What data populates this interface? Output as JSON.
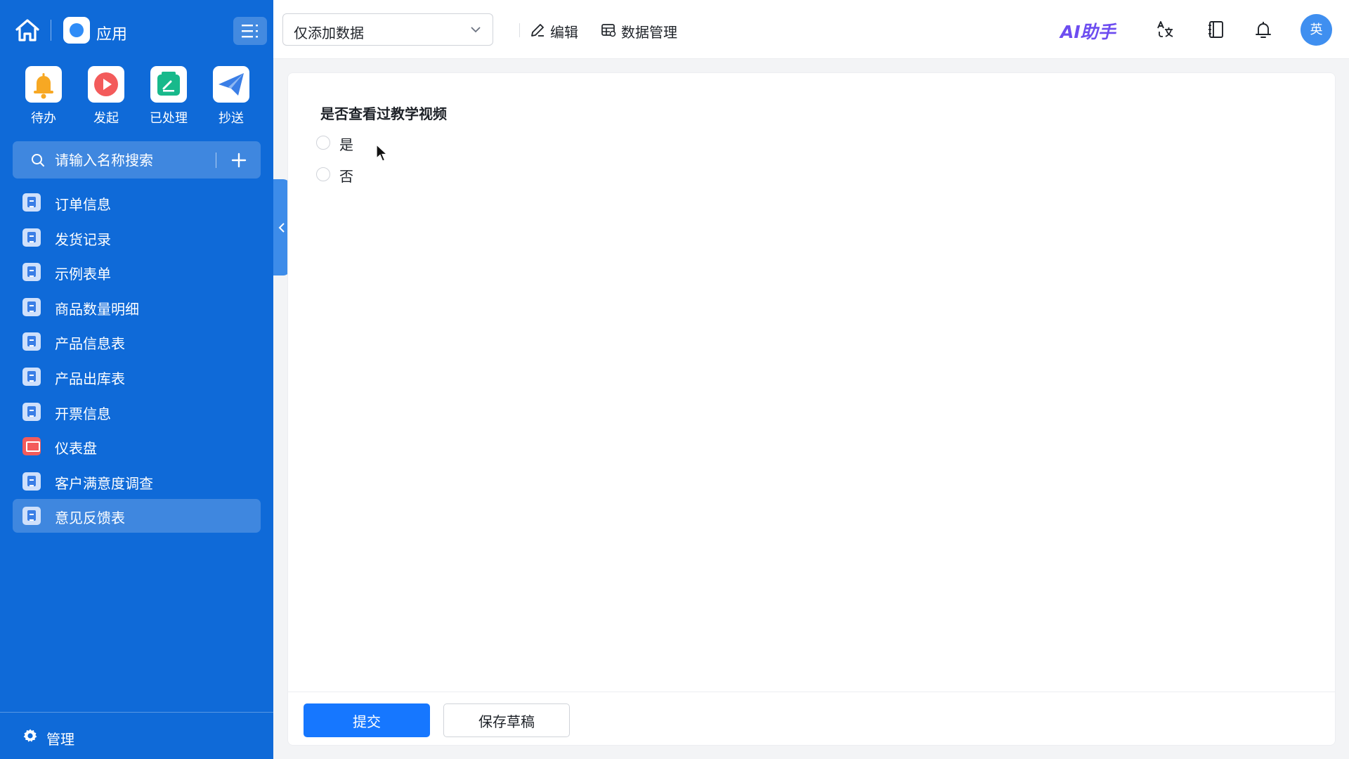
{
  "app": {
    "title": "应用"
  },
  "quick_actions": [
    {
      "label": "待办",
      "icon": "bell-icon",
      "color": "#f7a823"
    },
    {
      "label": "发起",
      "icon": "play-icon",
      "color": "#f35b5b"
    },
    {
      "label": "已处理",
      "icon": "check-doc-icon",
      "color": "#18b98b"
    },
    {
      "label": "抄送",
      "icon": "send-icon",
      "color": "#3a7ee6"
    }
  ],
  "search": {
    "placeholder": "请输入名称搜索"
  },
  "nav": {
    "items": [
      {
        "label": "订单信息",
        "type": "form"
      },
      {
        "label": "发货记录",
        "type": "form"
      },
      {
        "label": "示例表单",
        "type": "form"
      },
      {
        "label": "商品数量明细",
        "type": "form"
      },
      {
        "label": "产品信息表",
        "type": "form"
      },
      {
        "label": "产品出库表",
        "type": "form"
      },
      {
        "label": "开票信息",
        "type": "form"
      },
      {
        "label": "仪表盘",
        "type": "dashboard"
      },
      {
        "label": "客户满意度调查",
        "type": "form"
      },
      {
        "label": "意见反馈表",
        "type": "form",
        "active": true
      }
    ]
  },
  "footer": {
    "manage_label": "管理"
  },
  "topbar": {
    "mode_select": "仅添加数据",
    "edit_label": "编辑",
    "data_manage_label": "数据管理",
    "ai_label": "AI助手",
    "avatar_text": "英"
  },
  "form": {
    "question": "是否查看过教学视频",
    "options": [
      "是",
      "否"
    ]
  },
  "actions": {
    "submit_label": "提交",
    "draft_label": "保存草稿"
  },
  "colors": {
    "sidebar_bg": "#0f6ad8",
    "primary": "#1677ff",
    "ai": "#6d4df0"
  }
}
